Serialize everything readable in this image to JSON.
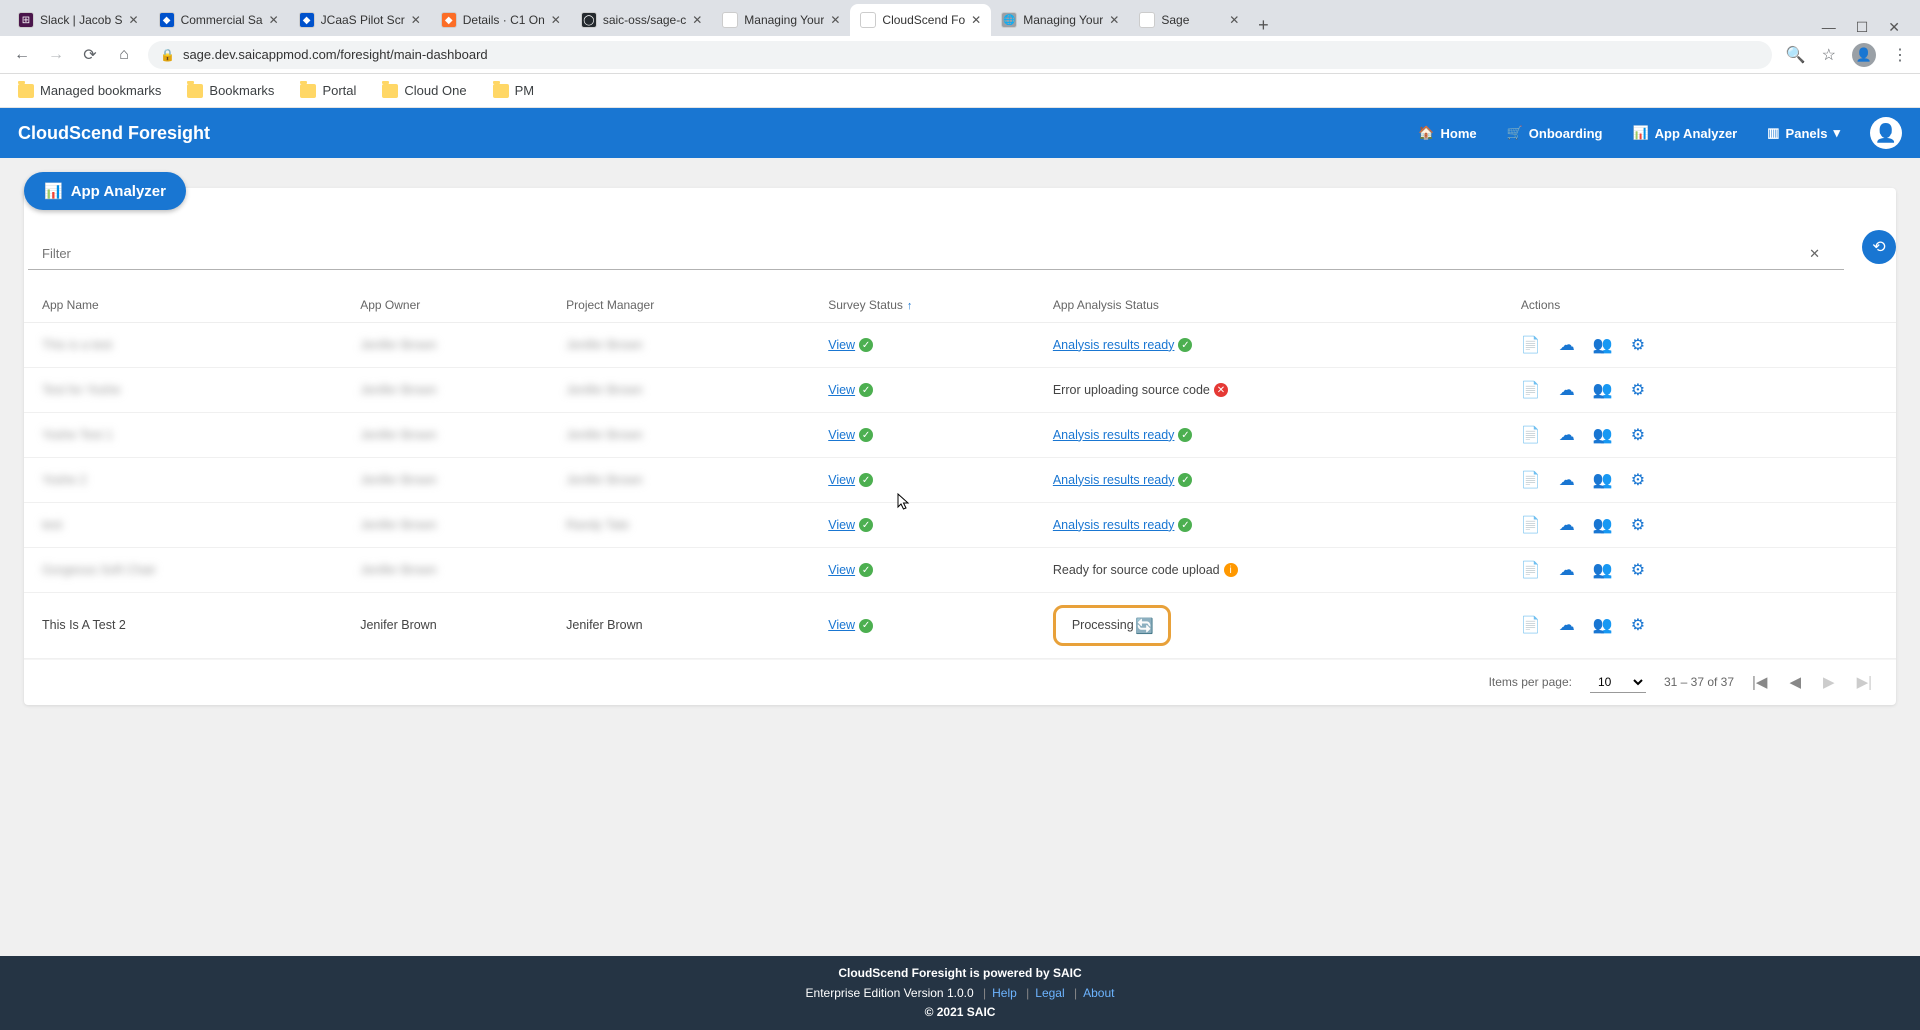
{
  "browser": {
    "tabs": [
      {
        "title": "Slack | Jacob S",
        "fav_bg": "#4a154b",
        "fav_text": "⊞"
      },
      {
        "title": "Commercial Sa",
        "fav_bg": "#0052cc",
        "fav_text": "◆"
      },
      {
        "title": "JCaaS Pilot Scr",
        "fav_bg": "#0052cc",
        "fav_text": "◆"
      },
      {
        "title": "Details · C1 On",
        "fav_bg": "#fc6d26",
        "fav_text": "◆"
      },
      {
        "title": "saic-oss/sage-c",
        "fav_bg": "#24292e",
        "fav_text": "◯"
      },
      {
        "title": "Managing Your",
        "fav_bg": "#ffffff",
        "fav_text": ""
      },
      {
        "title": "CloudScend Fo",
        "fav_bg": "#ffffff",
        "fav_text": ""
      },
      {
        "title": "Managing Your",
        "fav_bg": "#9aa0a6",
        "fav_text": "🌐"
      },
      {
        "title": "Sage",
        "fav_bg": "#ffffff",
        "fav_text": ""
      }
    ],
    "active_tab_index": 6,
    "url": "sage.dev.saicappmod.com/foresight/main-dashboard",
    "bookmarks": [
      "Managed bookmarks",
      "Bookmarks",
      "Portal",
      "Cloud One",
      "PM"
    ]
  },
  "header": {
    "brand": "CloudScend Foresight",
    "nav": {
      "home": "Home",
      "onboarding": "Onboarding",
      "app_analyzer": "App Analyzer",
      "panels": "Panels"
    }
  },
  "main": {
    "analyzer_button": "App Analyzer",
    "filter_placeholder": "Filter",
    "columns": {
      "app_name": "App Name",
      "app_owner": "App Owner",
      "project_manager": "Project Manager",
      "survey_status": "Survey Status",
      "app_analysis_status": "App Analysis Status",
      "actions": "Actions"
    },
    "view_label": "View",
    "status_labels": {
      "ready": "Analysis results ready",
      "error_upload": "Error uploading source code",
      "ready_upload": "Ready for source code upload",
      "processing": "Processing"
    },
    "rows": [
      {
        "app": "This is a test",
        "owner": "Jenifer Brown",
        "pm": "Jenifer Brown",
        "blur": true,
        "analysis": "ready",
        "download_enabled": true
      },
      {
        "app": "Test for Yoshe",
        "owner": "Jenifer Brown",
        "pm": "Jenifer Brown",
        "blur": true,
        "analysis": "error_upload",
        "download_enabled": true
      },
      {
        "app": "Yoshe Test 1",
        "owner": "Jenifer Brown",
        "pm": "Jenifer Brown",
        "blur": true,
        "analysis": "ready",
        "download_enabled": true
      },
      {
        "app": "Yoshe 2",
        "owner": "Jenifer Brown",
        "pm": "Jenifer Brown",
        "blur": true,
        "analysis": "ready",
        "download_enabled": true
      },
      {
        "app": "test",
        "owner": "Jenifer Brown",
        "pm": "Randy Tate",
        "blur": true,
        "analysis": "ready",
        "download_enabled": true
      },
      {
        "app": "Gorgeous Soft Chair",
        "owner": "Jenifer Brown",
        "pm": "",
        "blur": true,
        "analysis": "ready_upload",
        "download_enabled": true
      },
      {
        "app": "This Is A Test 2",
        "owner": "Jenifer Brown",
        "pm": "Jenifer Brown",
        "blur": false,
        "analysis": "processing",
        "download_enabled": false,
        "highlight": true
      }
    ],
    "paginator": {
      "items_per_page_label": "Items per page:",
      "items_per_page_value": "10",
      "range": "31 – 37 of 37"
    }
  },
  "footer": {
    "line1": "CloudScend Foresight is powered by SAIC",
    "edition": "Enterprise Edition Version 1.0.0",
    "help": "Help",
    "legal": "Legal",
    "about": "About",
    "copyright": "© 2021 SAIC"
  }
}
